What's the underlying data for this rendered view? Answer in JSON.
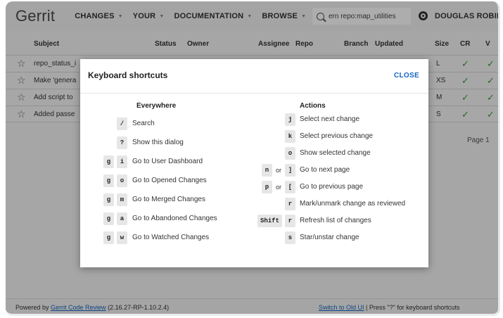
{
  "header": {
    "logo": "Gerrit",
    "nav": [
      "CHANGES",
      "YOUR",
      "DOCUMENTATION",
      "BROWSE"
    ],
    "search_value": "ern repo:map_utilities",
    "user": "DOUGLAS ROBINS"
  },
  "table": {
    "columns": [
      "Subject",
      "Status",
      "Owner",
      "Assignee",
      "Repo",
      "Branch",
      "Updated",
      "Size",
      "CR",
      "V"
    ],
    "rows": [
      {
        "subject": "repo_status_i",
        "size": "L"
      },
      {
        "subject": "Make 'genera",
        "size": "XS"
      },
      {
        "subject": "Add script to",
        "size": "M"
      },
      {
        "subject": "Added passe",
        "size": "S"
      }
    ],
    "check": "✓",
    "page_label": "Page 1"
  },
  "dialog": {
    "title": "Keyboard shortcuts",
    "close": "CLOSE",
    "or_label": "or",
    "everywhere": {
      "heading": "Everywhere",
      "items": [
        {
          "keys": [
            "/"
          ],
          "label": "Search"
        },
        {
          "keys": [
            "?"
          ],
          "label": "Show this dialog"
        },
        {
          "keys": [
            "g",
            "i"
          ],
          "label": "Go to User Dashboard"
        },
        {
          "keys": [
            "g",
            "o"
          ],
          "label": "Go to Opened Changes"
        },
        {
          "keys": [
            "g",
            "m"
          ],
          "label": "Go to Merged Changes"
        },
        {
          "keys": [
            "g",
            "a"
          ],
          "label": "Go to Abandoned Changes"
        },
        {
          "keys": [
            "g",
            "w"
          ],
          "label": "Go to Watched Changes"
        }
      ]
    },
    "actions": {
      "heading": "Actions",
      "items": [
        {
          "keys": [
            "j"
          ],
          "label": "Select next change"
        },
        {
          "keys": [
            "k"
          ],
          "label": "Select previous change"
        },
        {
          "keys": [
            "o"
          ],
          "label": "Show selected change"
        },
        {
          "keys": [
            "n",
            "]"
          ],
          "or": true,
          "label": "Go to next page"
        },
        {
          "keys": [
            "p",
            "["
          ],
          "or": true,
          "label": "Go to previous page"
        },
        {
          "keys": [
            "r"
          ],
          "label": "Mark/unmark change as reviewed"
        },
        {
          "keys": [
            "Shift",
            "r"
          ],
          "label": "Refresh list of changes"
        },
        {
          "keys": [
            "s"
          ],
          "label": "Star/unstar change"
        }
      ]
    }
  },
  "footer": {
    "powered_prefix": "Powered by ",
    "powered_link": "Gerrit Code Review",
    "version": " (2.16.27-RP-1.10.2.4)",
    "switch_link": "Switch to Old UI",
    "keyboard_hint": " | Press \"?\" for keyboard shortcuts"
  },
  "colors": {
    "accent": "#1565c0",
    "check": "#3a9a3a"
  }
}
